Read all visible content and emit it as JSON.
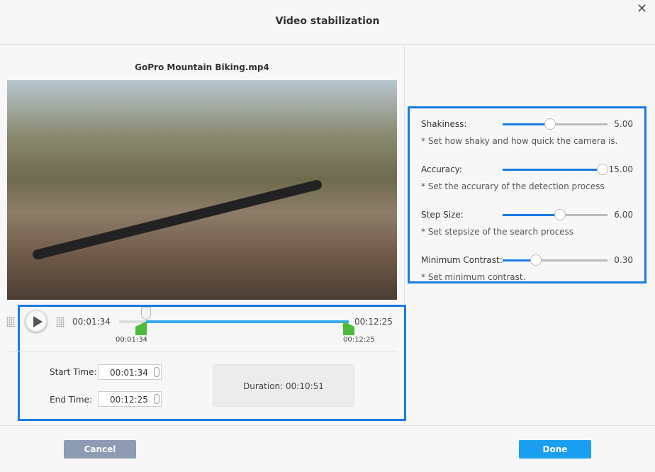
{
  "dialog": {
    "title": "Video stabilization"
  },
  "preview": {
    "filename": "GoPro Mountain Biking.mp4"
  },
  "trim": {
    "current_time": "00:01:34",
    "end_time_label": "00:12:25",
    "start_marker": "00:01:34",
    "end_marker": "00:12:25",
    "playhead_fraction": 0.12,
    "start_fraction": 0.12,
    "end_fraction": 1.0,
    "start_label": "Start Time:",
    "start_value": "00:01:34",
    "end_label": "End Time:",
    "end_value": "00:12:25",
    "duration_label": "Duration:",
    "duration_value": "00:10:51"
  },
  "settings": [
    {
      "label": "Shakiness:",
      "hint": "* Set how shaky and how quick the camera is.",
      "value": "5.00",
      "fraction": 0.45
    },
    {
      "label": "Accuracy:",
      "hint": "* Set the accurary of the detection process",
      "value": "15.00",
      "fraction": 0.95
    },
    {
      "label": "Step Size:",
      "hint": "* Set stepsize of the search process",
      "value": "6.00",
      "fraction": 0.55
    },
    {
      "label": "Minimum Contrast:",
      "hint": "* Set minimum contrast.",
      "value": "0.30",
      "fraction": 0.32
    }
  ],
  "footer": {
    "cancel": "Cancel",
    "done": "Done"
  },
  "colors": {
    "accent": "#1a7be0",
    "done": "#1a9ff0",
    "cancel": "#8d9bb3",
    "marker": "#4cbb3c",
    "track": "#33aaee"
  }
}
